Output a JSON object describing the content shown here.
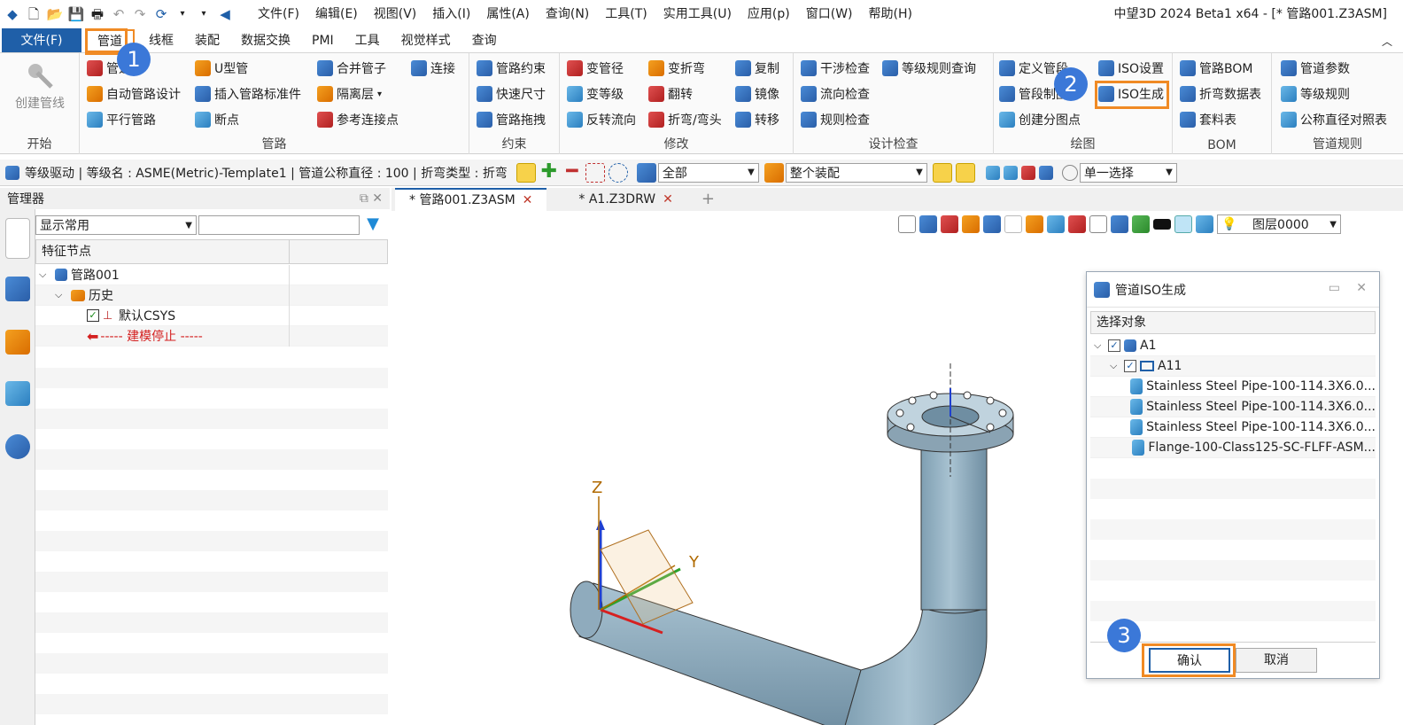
{
  "title_bar": {
    "menus": [
      "文件(F)",
      "编辑(E)",
      "视图(V)",
      "插入(I)",
      "属性(A)",
      "查询(N)",
      "工具(T)",
      "实用工具(U)",
      "应用(p)",
      "窗口(W)",
      "帮助(H)"
    ],
    "app_title": "中望3D 2024 Beta1 x64 - [* 管路001.Z3ASM]"
  },
  "ribbon_tabs": {
    "file": "文件(F)",
    "tabs": [
      "管道",
      "线框",
      "装配",
      "数据交换",
      "PMI",
      "工具",
      "视觉样式",
      "查询"
    ],
    "active": "管道"
  },
  "ribbon": {
    "groups": {
      "start": "开始",
      "pipe": "管路",
      "constraint": "约束",
      "modify": "修改",
      "check": "设计检查",
      "draw": "绘图",
      "bom": "BOM",
      "rules": "管道规则"
    },
    "create_pipeline": "创建管线",
    "pipe_items": [
      "管道",
      "自动管路设计",
      "平行管路",
      "U型管",
      "插入管路标准件",
      "断点",
      "合并管子",
      "隔离层",
      "参考连接点",
      "连接"
    ],
    "constraint_items": [
      "管路约束",
      "快速尺寸",
      "管路拖拽"
    ],
    "modify_items": [
      "变管径",
      "变等级",
      "反转流向",
      "变折弯",
      "翻转",
      "折弯/弯头",
      "复制",
      "镜像",
      "转移"
    ],
    "check_items": [
      "干涉检查",
      "流向检查",
      "规则检查",
      "等级规则查询"
    ],
    "draw_items": [
      "定义管段",
      "管段制图",
      "创建分图点",
      "ISO设置",
      "ISO生成"
    ],
    "bom_items": [
      "管路BOM",
      "折弯数据表",
      "套料表"
    ],
    "rules_items": [
      "管道参数",
      "等级规则",
      "公称直径对照表"
    ]
  },
  "command_bar": {
    "pipe_info": "等级驱动 | 等级名 : ASME(Metric)-Template1 | 管道公称直径 : 100 | 折弯类型 : 折弯",
    "filter_combo": "全部",
    "scope_combo": "整个装配",
    "select_combo": "单一选择"
  },
  "manager": {
    "title": "管理器",
    "filter_combo": "显示常用",
    "tree_header": "特征节点",
    "tree": [
      {
        "label": "管路001",
        "level": 0
      },
      {
        "label": "历史",
        "level": 1
      },
      {
        "label": "默认CSYS",
        "level": 2
      },
      {
        "label": "----- 建模停止 -----",
        "level": 2
      }
    ]
  },
  "doc_tabs": [
    "* 管路001.Z3ASM",
    "* A1.Z3DRW"
  ],
  "viewport": {
    "layer_combo": "图层0000",
    "axis_labels": {
      "z": "Z",
      "y": "Y"
    }
  },
  "dialog": {
    "title": "管道ISO生成",
    "section": "选择对象",
    "tree": [
      {
        "label": "A1",
        "level": 0
      },
      {
        "label": "A11",
        "level": 1
      },
      {
        "label": "Stainless Steel Pipe-100-114.3X6.0...",
        "level": 2
      },
      {
        "label": "Stainless Steel Pipe-100-114.3X6.0...",
        "level": 2
      },
      {
        "label": "Stainless Steel Pipe-100-114.3X6.0...",
        "level": 2
      },
      {
        "label": "Flange-100-Class125-SC-FLFF-ASM...",
        "level": 2
      }
    ],
    "ok": "确认",
    "cancel": "取消"
  },
  "callouts": [
    "1",
    "2",
    "3"
  ],
  "colors": {
    "accent": "#1f5fa8",
    "highlight": "#f08a24",
    "badge": "#3b78d8",
    "pipe": "#8aaabb"
  }
}
